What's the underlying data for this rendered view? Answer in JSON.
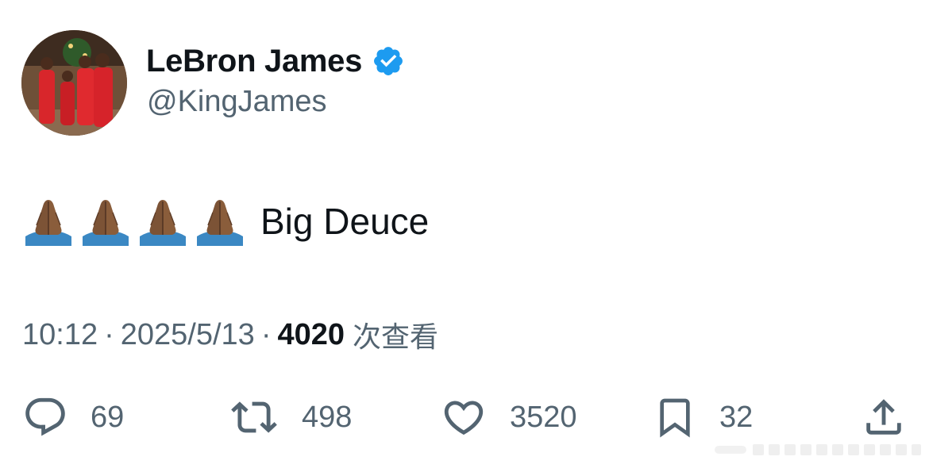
{
  "author": {
    "display_name": "LeBron James",
    "handle": "@KingJames",
    "verified": true
  },
  "tweet": {
    "emoji": [
      "🙏🏾",
      "🙏🏾",
      "🙏🏾",
      "🙏🏾"
    ],
    "text": "Big Deuce"
  },
  "meta": {
    "time": "10:12",
    "separator": "·",
    "date": "2025/5/13",
    "views_count": "4020",
    "views_label": "次查看"
  },
  "actions": {
    "replies": "69",
    "retweets": "498",
    "likes": "3520",
    "bookmarks": "32"
  },
  "icons": {
    "verified": "verified-badge-icon",
    "reply": "reply-icon",
    "retweet": "retweet-icon",
    "like": "heart-icon",
    "bookmark": "bookmark-icon",
    "share": "share-icon",
    "emoji": "folded-hands-icon"
  },
  "colors": {
    "text_primary": "#0f1419",
    "text_secondary": "#536471",
    "verified_blue": "#1d9bf0",
    "icon_gray": "#536471"
  }
}
